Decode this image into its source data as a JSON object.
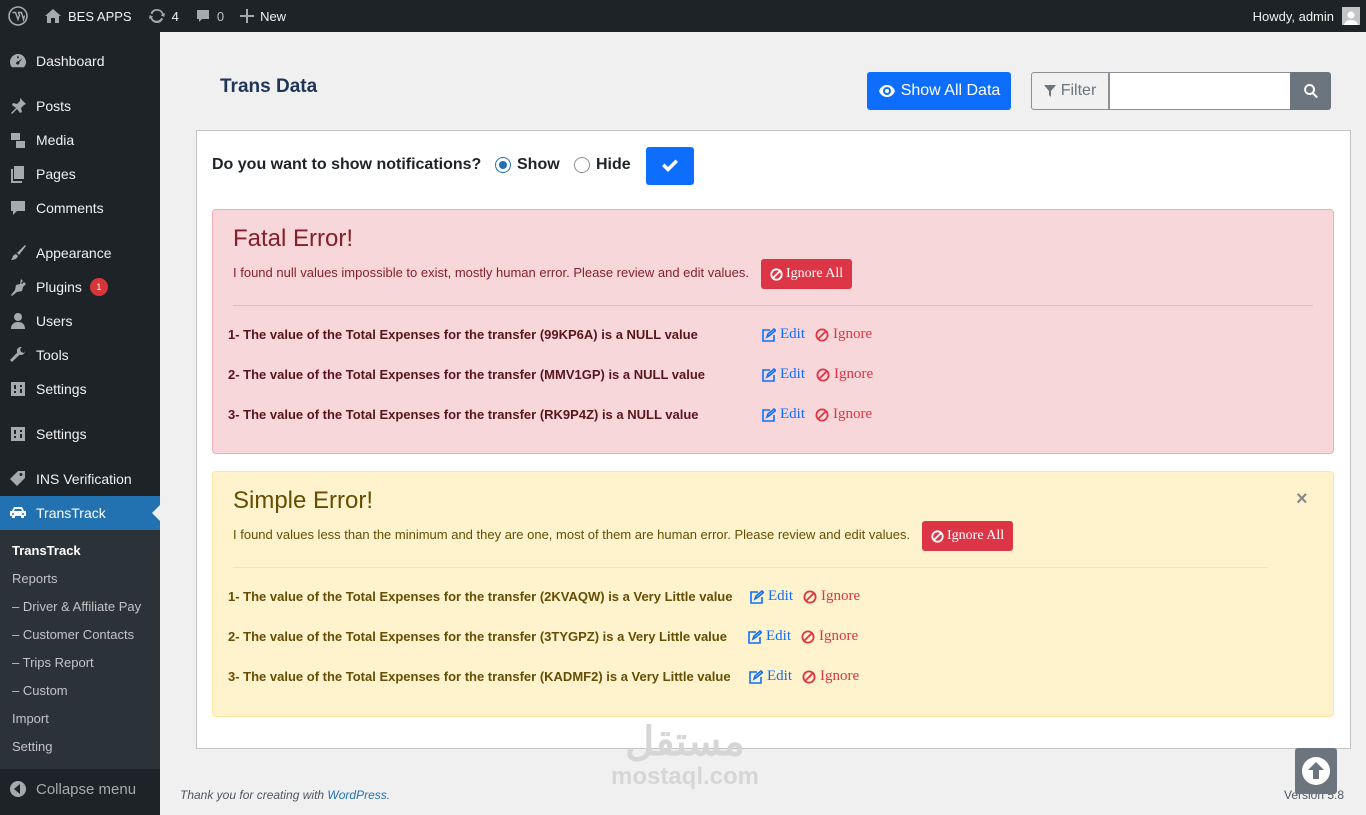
{
  "adminbar": {
    "site_name": "BES APPS",
    "updates_count": "4",
    "comments_count": "0",
    "new_label": "New",
    "howdy": "Howdy, admin"
  },
  "sidebar": {
    "items": [
      {
        "label": "Dashboard",
        "icon": "dashboard-icon"
      },
      {
        "label": "Posts",
        "icon": "pin-icon"
      },
      {
        "label": "Media",
        "icon": "media-icon"
      },
      {
        "label": "Pages",
        "icon": "pages-icon"
      },
      {
        "label": "Comments",
        "icon": "comment-icon"
      },
      {
        "label": "Appearance",
        "icon": "brush-icon"
      },
      {
        "label": "Plugins",
        "icon": "plugin-icon",
        "badge": "1"
      },
      {
        "label": "Users",
        "icon": "user-icon"
      },
      {
        "label": "Tools",
        "icon": "wrench-icon"
      },
      {
        "label": "Settings",
        "icon": "settings-icon"
      },
      {
        "label": "Settings",
        "icon": "settings-icon"
      },
      {
        "label": "INS Verification",
        "icon": "tag-icon"
      },
      {
        "label": "TransTrack",
        "icon": "car-icon",
        "active": true
      }
    ],
    "submenu": [
      "TransTrack",
      "Reports",
      "– Driver & Affiliate Pay",
      "– Customer Contacts",
      "– Trips Report",
      "– Custom",
      "Import",
      "Setting"
    ],
    "collapse_label": "Collapse menu"
  },
  "main": {
    "title": "Trans Data",
    "show_all_label": "Show All Data",
    "filter_label": "Filter",
    "search_value": ""
  },
  "notifications": {
    "question": "Do you want to show notifications?",
    "options": [
      "Show",
      "Hide"
    ],
    "selected": "Show"
  },
  "fatal": {
    "title": "Fatal Error!",
    "message": "I found null values impossible to exist, mostly human error. Please review and edit values.",
    "ignore_all_label": "Ignore All",
    "rows": [
      "1- The value of the Total Expenses for the transfer (99KP6A) is a NULL value",
      "2- The value of the Total Expenses for the transfer (MMV1GP) is a NULL value",
      "3- The value of the Total Expenses for the transfer (RK9P4Z) is a NULL value"
    ]
  },
  "simple": {
    "title": "Simple Error!",
    "message": "I found values less than the minimum and they are one, most of them are human error. Please review and edit values.",
    "ignore_all_label": "Ignore All",
    "close_label": "×",
    "rows": [
      "1- The value of the Total Expenses for the transfer (2KVAQW) is a Very Little value",
      "2- The value of the Total Expenses for the transfer (3TYGPZ) is a Very Little value",
      "3- The value of the Total Expenses for the transfer (KADMF2) is a Very Little value"
    ]
  },
  "actions": {
    "edit_label": "Edit",
    "ignore_label": "Ignore"
  },
  "footer": {
    "thanks_text": "Thank you for creating with ",
    "link_text": "WordPress",
    "period": ".",
    "version": "Version 5.8"
  },
  "watermark": {
    "arabic": "مستقل",
    "latin": "mostaql.com"
  },
  "colors": {
    "primary": "#0d6efd",
    "danger": "#dc3545",
    "sidebar_bg": "#1d2327",
    "active_menu": "#2271b1"
  }
}
